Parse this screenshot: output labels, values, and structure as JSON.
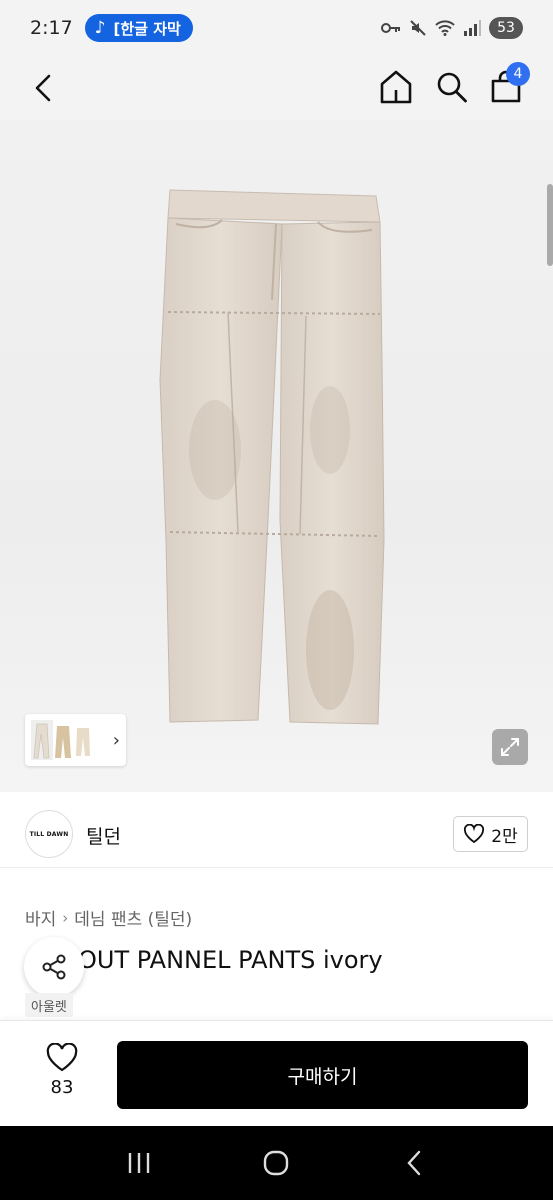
{
  "status_bar": {
    "time": "2:17",
    "music_label": "[한글 자막",
    "battery": "53"
  },
  "header": {
    "cart_count": "4"
  },
  "brand": {
    "logo_text": "TILL DAWN",
    "name": "틸던",
    "like_count": "2만"
  },
  "product": {
    "breadcrumb": [
      "바지",
      "데님 팬츠 (틸던)"
    ],
    "title": "OUT PANNEL PANTS ivory",
    "tag": "아울렛"
  },
  "action_bar": {
    "like_count": "83",
    "buy_label": "구매하기"
  },
  "colors": {
    "accent_blue": "#2f6ff0",
    "buy_button": "#000000"
  },
  "icons": [
    "back-icon",
    "home-icon",
    "search-icon",
    "bag-icon",
    "expand-icon",
    "heart-icon",
    "share-icon"
  ]
}
